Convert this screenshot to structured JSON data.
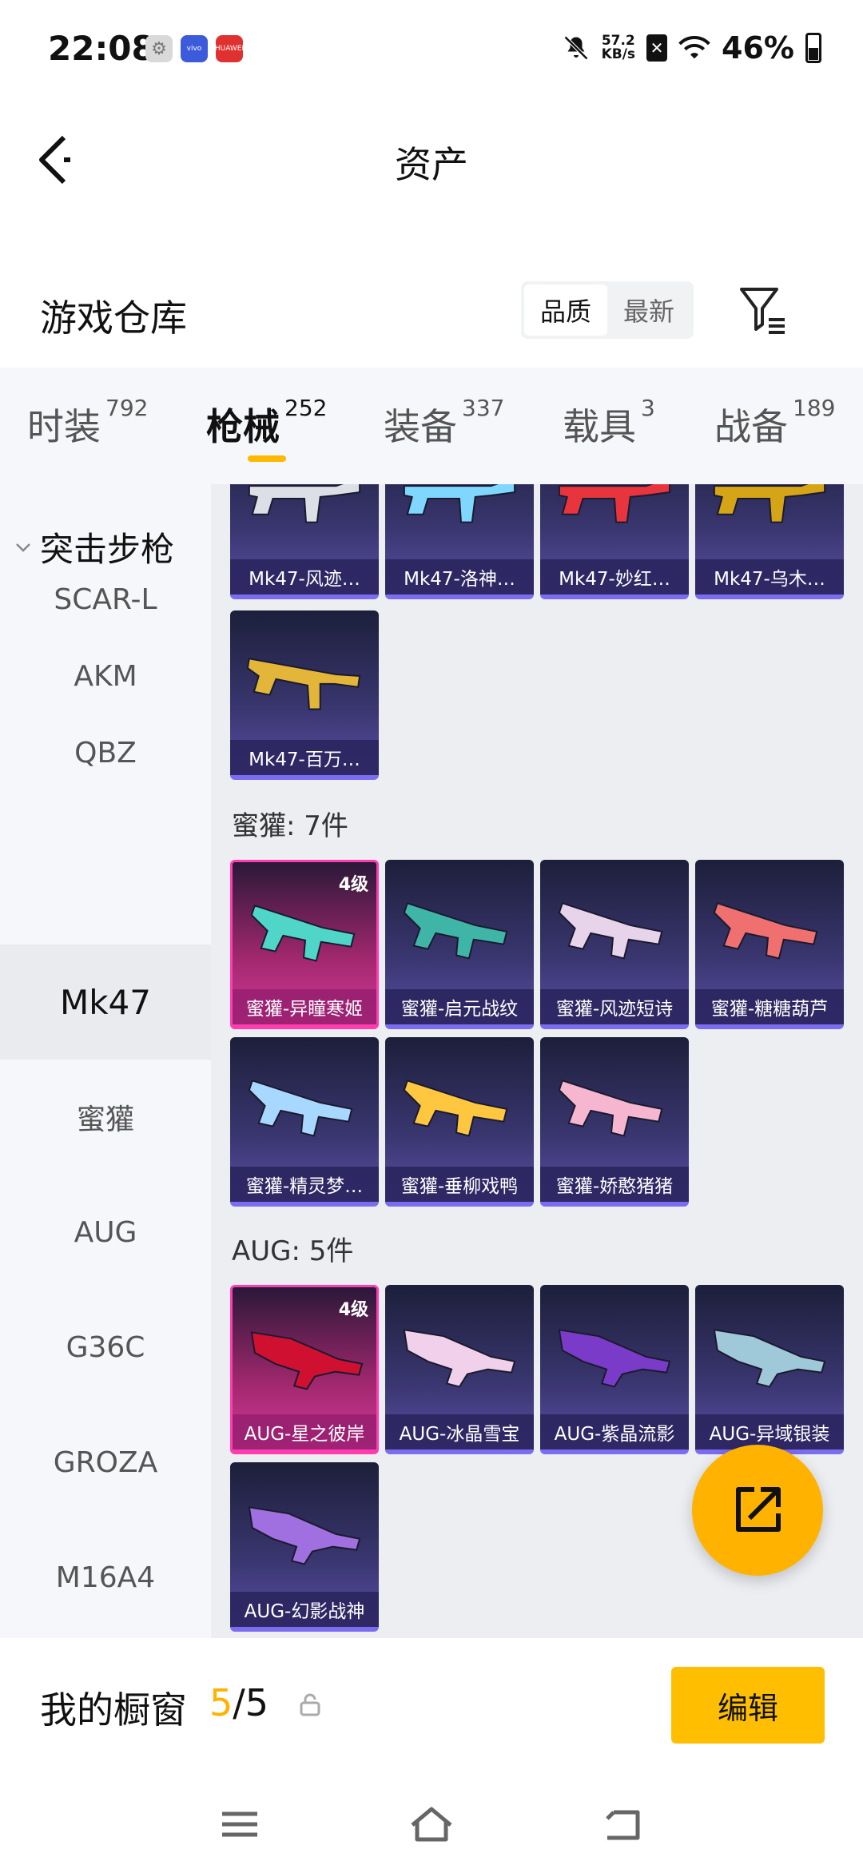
{
  "status_bar": {
    "time": "22:08",
    "net_speed_value": "57.2",
    "net_speed_unit": "KB/s",
    "battery": "46%",
    "notif_blue": "vivo",
    "notif_red": "HUAWEI"
  },
  "header": {
    "title": "资产"
  },
  "warehouse": {
    "title": "游戏仓库",
    "sort_options": [
      "品质",
      "最新"
    ],
    "active_sort": "品质"
  },
  "category_tabs": [
    {
      "label": "时装",
      "count": "792"
    },
    {
      "label": "枪械",
      "count": "252"
    },
    {
      "label": "装备",
      "count": "337"
    },
    {
      "label": "载具",
      "count": "3"
    },
    {
      "label": "战备",
      "count": "189"
    }
  ],
  "active_tab": "枪械",
  "sidebar": {
    "group": "突击步枪",
    "items": [
      "SCAR-L",
      "AKM",
      "QBZ",
      "Mk47",
      "蜜獾",
      "AUG",
      "G36C",
      "GROZA",
      "M16A4"
    ],
    "active": "Mk47"
  },
  "sections": {
    "mk47_cards": [
      "Mk47-风迹…",
      "Mk47-洛神…",
      "Mk47-妙红…",
      "Mk47-乌木…",
      "Mk47-百万…"
    ],
    "honeybadger_title": "蜜獾: 7件",
    "honeybadger_cards": [
      "蜜獾-异瞳寒姬",
      "蜜獾-启元战纹",
      "蜜獾-风迹短诗",
      "蜜獾-糖糖葫芦",
      "蜜獾-精灵梦…",
      "蜜獾-垂柳戏鸭",
      "蜜獾-娇憨猪猪"
    ],
    "aug_title": "AUG: 5件",
    "aug_cards": [
      "AUG-星之彼岸",
      "AUG-冰晶雪宝",
      "AUG-紫晶流影",
      "AUG-异域银装",
      "AUG-幻影战神"
    ],
    "level_badge": "4级"
  },
  "gun_colors": {
    "mk47": [
      "#dcdfe6",
      "#7fd6ff",
      "#e8343c",
      "#d6a417",
      "#e3b63a"
    ],
    "honeybadger": [
      "#4fd6c8",
      "#3fb5a8",
      "#e8d4ea",
      "#f07070",
      "#a8d8ff",
      "#ffc740",
      "#f6b6d0"
    ],
    "aug": [
      "#d01030",
      "#f0d0ea",
      "#7a3cc8",
      "#9fc8d8",
      "#a070e0"
    ]
  },
  "showcase": {
    "label": "我的橱窗",
    "count_highlight": "5",
    "count_rest": "/5",
    "edit_label": "编辑"
  }
}
